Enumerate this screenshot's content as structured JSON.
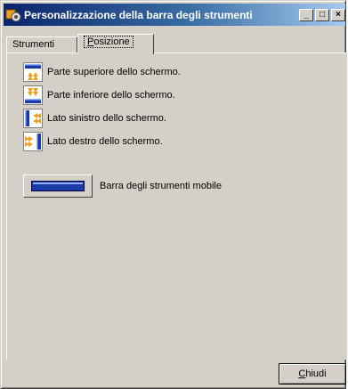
{
  "window": {
    "title": "Personalizzazione della barra degli strumenti",
    "controls": {
      "minimize": "_",
      "maximize": "□",
      "close": "×"
    }
  },
  "tabs": [
    {
      "label_u": "",
      "label_rest": "Strumenti",
      "active": false
    },
    {
      "label_u": "P",
      "label_rest": "osizione",
      "active": true
    }
  ],
  "positions": [
    {
      "icon": "toolbar-top-icon",
      "label": "Parte superiore dello schermo."
    },
    {
      "icon": "toolbar-bottom-icon",
      "label": "Parte inferiore dello schermo."
    },
    {
      "icon": "toolbar-left-icon",
      "label": "Lato sinistro dello schermo."
    },
    {
      "icon": "toolbar-right-icon",
      "label": "Lato destro dello schermo."
    }
  ],
  "floating": {
    "icon": "toolbar-floating-icon",
    "label": "Barra degli strumenti mobile"
  },
  "close_button": {
    "label_u": "C",
    "label_rest": "hiudi"
  },
  "colors": {
    "toolbar_blue": "#1a3aa8",
    "arrow_orange": "#f0a020",
    "titlebar": "#0a246a"
  }
}
